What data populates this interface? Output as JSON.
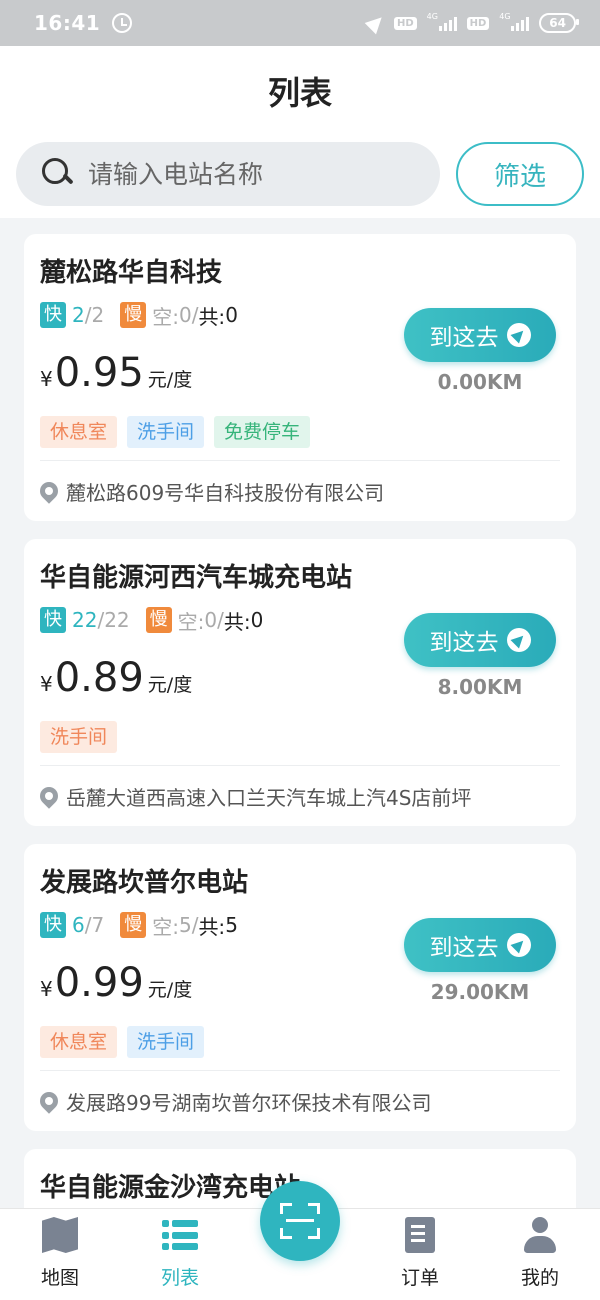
{
  "status_bar": {
    "time": "16:41",
    "hd1": "HD",
    "net1": "4G",
    "hd2": "HD",
    "net2": "4G",
    "battery": "64"
  },
  "header": {
    "title": "列表"
  },
  "search": {
    "placeholder": "请输入电站名称",
    "value": ""
  },
  "filter_label": "筛选",
  "labels": {
    "fast": "快",
    "slow": "慢",
    "empty_prefix": "空:",
    "total_prefix": "共:",
    "currency": "¥",
    "price_unit": "元/度",
    "go": "到这去"
  },
  "stations": [
    {
      "name": "麓松路华自科技",
      "fast_available": "2",
      "fast_total": "/2",
      "slow_empty": "0",
      "slow_total": "0",
      "price": "0.95",
      "amenities": [
        {
          "label": "休息室",
          "color": "orange"
        },
        {
          "label": "洗手间",
          "color": "blue"
        },
        {
          "label": "免费停车",
          "color": "green"
        }
      ],
      "distance": "0.00KM",
      "address": "麓松路609号华自科技股份有限公司"
    },
    {
      "name": "华自能源河西汽车城充电站",
      "fast_available": "22",
      "fast_total": "/22",
      "slow_empty": "0",
      "slow_total": "0",
      "price": "0.89",
      "amenities": [
        {
          "label": "洗手间",
          "color": "orange"
        }
      ],
      "distance": "8.00KM",
      "address": "岳麓大道西高速入口兰天汽车城上汽4S店前坪"
    },
    {
      "name": "发展路坎普尔电站",
      "fast_available": "6",
      "fast_total": "/7",
      "slow_empty": "5",
      "slow_total": "5",
      "price": "0.99",
      "amenities": [
        {
          "label": "休息室",
          "color": "orange"
        },
        {
          "label": "洗手间",
          "color": "blue"
        }
      ],
      "distance": "29.00KM",
      "address": "发展路99号湖南坎普尔环保技术有限公司"
    },
    {
      "name": "华自能源金沙湾充电站"
    }
  ],
  "bottom_nav": {
    "map": "地图",
    "list": "列表",
    "orders": "订单",
    "mine": "我的"
  },
  "colors": {
    "accent": "#2fb5bf",
    "fast": "#2fb5bf",
    "slow": "#f08a3c"
  }
}
